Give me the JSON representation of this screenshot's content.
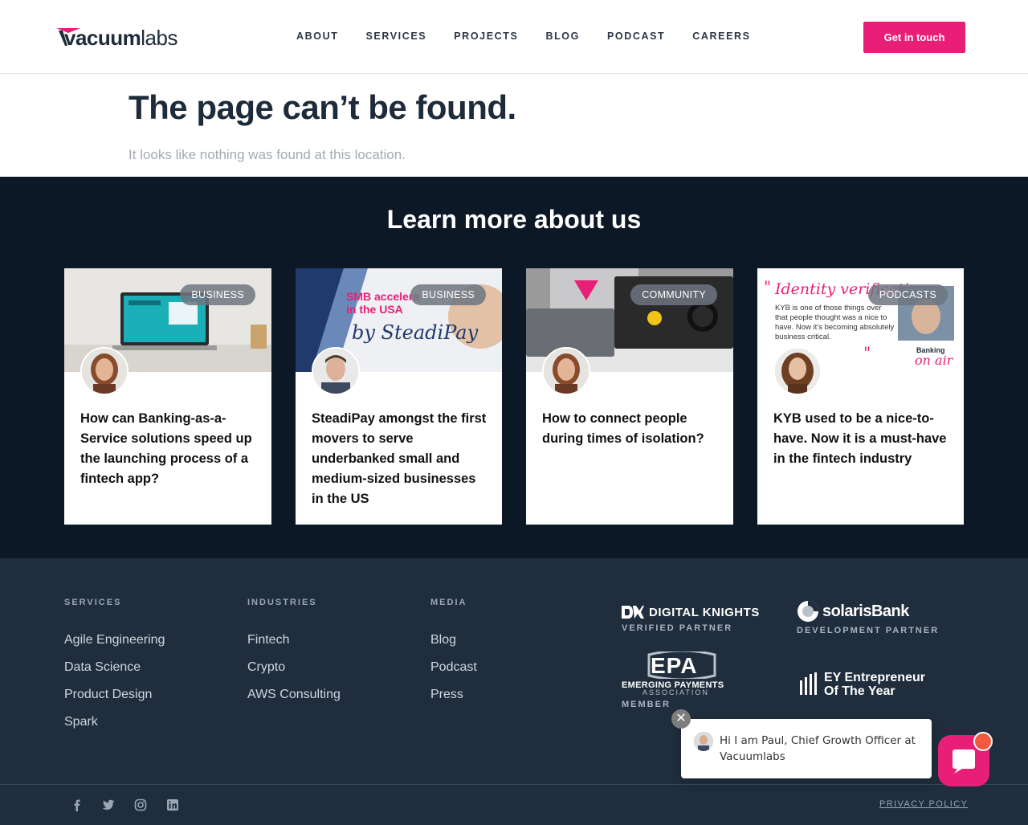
{
  "header": {
    "logo_bold": "vacuum",
    "logo_light": "labs",
    "nav": [
      "ABOUT",
      "SERVICES",
      "PROJECTS",
      "BLOG",
      "PODCAST",
      "CAREERS"
    ],
    "cta": "Get in touch"
  },
  "notfound": {
    "title": "The page can’t be found.",
    "subtitle": "It looks like nothing was found at this location."
  },
  "learn": {
    "title": "Learn more about us",
    "cards": [
      {
        "tag": "BUSINESS",
        "title": "How can Banking-as-a-Service solutions speed up the launching process of a fintech app?"
      },
      {
        "tag": "BUSINESS",
        "title": "SteadiPay amongst the first movers to serve underbanked small and medium-sized businesses in the US",
        "img_text_1": "SMB accelera",
        "img_text_2": "in the USA",
        "img_text_3": "by SteadiPay"
      },
      {
        "tag": "COMMUNITY",
        "title": "How to connect people during times of isolation?"
      },
      {
        "tag": "PODCASTS",
        "title": "KYB used to be a nice-to-have. Now it is a must-have in the fintech industry",
        "img_text_1": "Identity verificati",
        "img_text_2": "KYB is one of those things over that people thought was a nice to have. Now it’s becoming absolutely business critical.",
        "img_text_3": "Banking",
        "img_text_4": "on air"
      }
    ]
  },
  "footer": {
    "services": {
      "head": "SERVICES",
      "items": [
        "Agile Engineering",
        "Data Science",
        "Product Design",
        "Spark"
      ]
    },
    "industries": {
      "head": "INDUSTRIES",
      "items": [
        "Fintech",
        "Crypto",
        "AWS Consulting"
      ]
    },
    "media": {
      "head": "MEDIA",
      "items": [
        "Blog",
        "Podcast",
        "Press"
      ]
    },
    "partners": {
      "dk_name": "DIGITAL KNIGHTS",
      "dk_label": "VERIFIED PARTNER",
      "solaris_name": "solarisBank",
      "solaris_label": "DEVELOPMENT PARTNER",
      "epa_mark": "EPA",
      "epa_name": "EMERGING PAYMENTS",
      "epa_sub": "ASSOCIATION",
      "epa_label": "MEMBER",
      "ey_line1": "EY Entrepreneur",
      "ey_line2": "Of The Year"
    },
    "privacy": "PRIVACY POLICY"
  },
  "chat": {
    "message": "Hi I am Paul, Chief Growth Officer at Vacuumlabs",
    "close": "✕"
  },
  "colors": {
    "brand": "#e91e76",
    "dark": "#0c1825",
    "footer": "#1f2d3d"
  }
}
